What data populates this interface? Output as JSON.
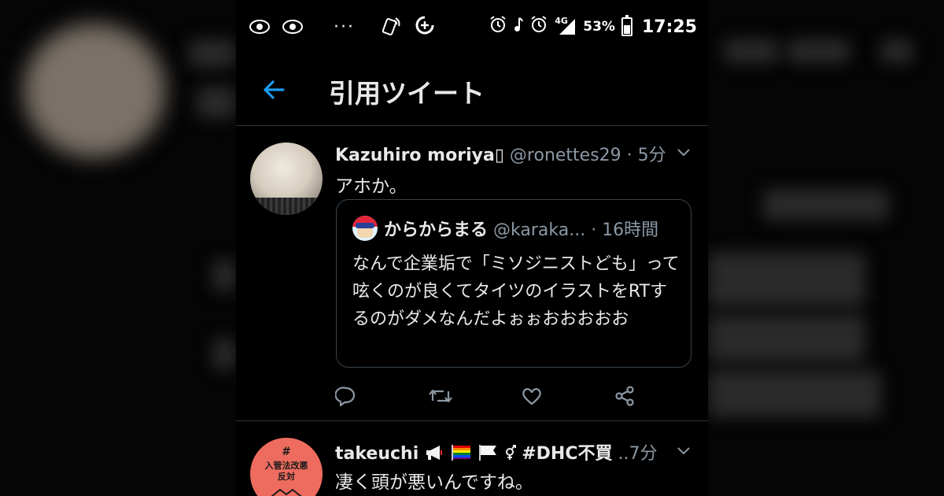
{
  "status_bar": {
    "dots": "···",
    "network": "4G",
    "battery_pct": "53%",
    "time": "17:25"
  },
  "header": {
    "title": "引用ツイート"
  },
  "tweet1": {
    "name": "Kazuhiro moriya",
    "handle": "@ronettes29",
    "sep": " · ",
    "time": "5分",
    "body": "アホか。",
    "quote": {
      "name": "からからまる",
      "handle": "@karaka...",
      "sep": " · ",
      "time": "16時間",
      "body": "なんで企業垢で「ミソジニストども」って呟くのが良くてタイツのイラストをRTするのがダメなんだよぉぉおおおおお"
    }
  },
  "tweet2": {
    "avatar_hash": "#",
    "avatar_line1": "入管法改悪",
    "avatar_line2": "反対",
    "name": "takeuchi",
    "hashtag": "#DHC不買",
    "ellipsis": " ..",
    "time": "7分",
    "body": "凄く頭が悪いんですね。"
  },
  "icons": [
    "back-arrow-icon",
    "reply-icon",
    "retweet-icon",
    "like-icon",
    "share-icon",
    "chevron-down-icon",
    "alarm-icon",
    "music-note-icon",
    "signal-icon",
    "battery-icon",
    "nfc-icon",
    "data-saver-icon"
  ],
  "colors": {
    "background": "#000000",
    "accent": "#1d9bf0",
    "secondary_text": "#8b98a5",
    "border": "#2f3336",
    "avatar2": "#ee6c5f"
  }
}
